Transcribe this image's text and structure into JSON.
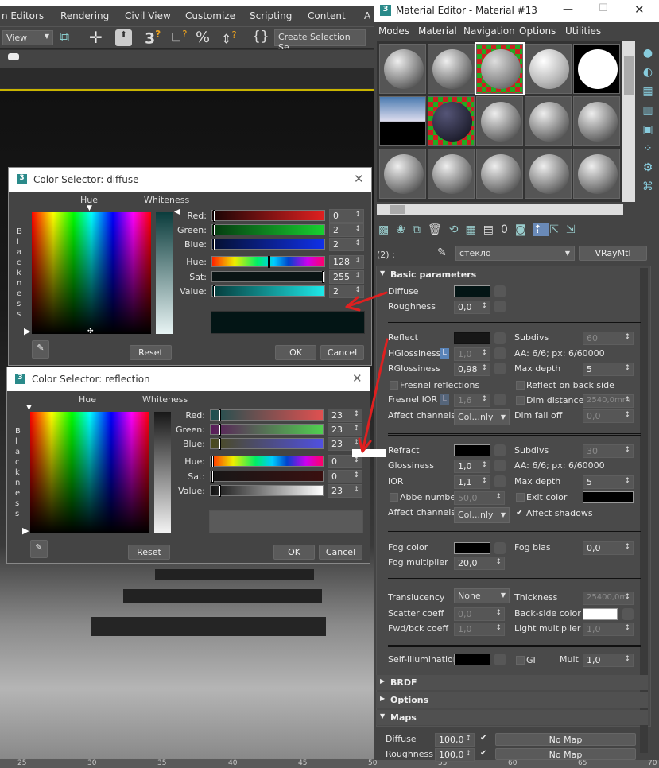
{
  "main_menu": [
    "n Editors",
    "Rendering",
    "Civil View",
    "Customize",
    "Scripting",
    "Content",
    "A"
  ],
  "toolbar": {
    "view_dropdown": "View",
    "selection_set": "Create Selection Se"
  },
  "ruler_ticks": [
    "25",
    "30",
    "35",
    "40",
    "45",
    "50",
    "55",
    "60",
    "65",
    "70"
  ],
  "material_editor": {
    "title": "Material Editor - Material #13",
    "menu": [
      "Modes",
      "Material",
      "Navigation",
      "Options",
      "Utilities"
    ],
    "slot_label": "(2) :",
    "material_name": "стекло",
    "material_type": "VRayMtl",
    "basic_parameters": "Basic parameters",
    "diffuse": {
      "label": "Diffuse",
      "color": "#031515"
    },
    "roughness": {
      "label": "Roughness",
      "value": "0,0"
    },
    "reflect": {
      "label": "Reflect",
      "color": "#171717"
    },
    "subdivs_reflect": {
      "label": "Subdivs",
      "value": "60"
    },
    "hglossiness": {
      "label": "HGlossiness",
      "lock": "L",
      "value": "1,0"
    },
    "aa_reflect": "AA: 6/6; px: 6/60000",
    "rglossiness": {
      "label": "RGlossiness",
      "value": "0,98"
    },
    "max_depth_reflect": {
      "label": "Max depth",
      "value": "5"
    },
    "fresnel": {
      "label": "Fresnel reflections",
      "checked": false
    },
    "reflect_back": {
      "label": "Reflect on back side",
      "checked": false
    },
    "fresnel_ior": {
      "label": "Fresnel IOR",
      "lock": "L",
      "value": "1,6"
    },
    "dim_distance": {
      "label": "Dim distance",
      "value": "2540,0mm",
      "checked": false
    },
    "affect_channels_reflect": {
      "label": "Affect channels",
      "value": "Col...nly"
    },
    "dim_falloff": {
      "label": "Dim fall off",
      "value": "0,0"
    },
    "refract": {
      "label": "Refract",
      "color": "#000000"
    },
    "subdivs_refract": {
      "label": "Subdivs",
      "value": "30"
    },
    "glossiness": {
      "label": "Glossiness",
      "value": "1,0"
    },
    "aa_refract": "AA: 6/6; px: 6/60000",
    "ior": {
      "label": "IOR",
      "value": "1,1"
    },
    "max_depth_refract": {
      "label": "Max depth",
      "value": "5"
    },
    "abbe": {
      "label": "Abbe number",
      "value": "50,0",
      "checked": false
    },
    "exit_color": {
      "label": "Exit color",
      "checked": false,
      "color": "#000000"
    },
    "affect_channels_refract": {
      "label": "Affect channels",
      "value": "Col...nly"
    },
    "affect_shadows": {
      "label": "Affect shadows",
      "checked": true
    },
    "fog_color": {
      "label": "Fog color",
      "color": "#000000"
    },
    "fog_bias": {
      "label": "Fog bias",
      "value": "0,0"
    },
    "fog_multiplier": {
      "label": "Fog multiplier",
      "value": "20,0"
    },
    "translucency": {
      "label": "Translucency",
      "value": "None"
    },
    "thickness": {
      "label": "Thickness",
      "value": "25400,0m"
    },
    "scatter": {
      "label": "Scatter coeff",
      "value": "0,0"
    },
    "back_side": {
      "label": "Back-side color",
      "color": "#ffffff"
    },
    "fwd_bck": {
      "label": "Fwd/bck coeff",
      "value": "1,0"
    },
    "light_mult": {
      "label": "Light multiplier",
      "value": "1,0"
    },
    "self_illum": {
      "label": "Self-illumination",
      "color": "#000000"
    },
    "gi": {
      "label": "GI",
      "checked": false
    },
    "mult": {
      "label": "Mult",
      "value": "1,0"
    },
    "rollouts": {
      "brdf": "BRDF",
      "options": "Options",
      "maps": "Maps"
    },
    "maps": [
      {
        "label": "Diffuse",
        "value": "100,0",
        "checked": true,
        "map": "No Map"
      },
      {
        "label": "Roughness",
        "value": "100,0",
        "checked": true,
        "map": "No Map"
      }
    ]
  },
  "cs_diffuse": {
    "title": "Color Selector: diffuse",
    "hue": "Hue",
    "whiteness": "Whiteness",
    "blackness": "Blackness",
    "labels": [
      "Red:",
      "Green:",
      "Blue:",
      "Hue:",
      "Sat:",
      "Value:"
    ],
    "values": [
      "0",
      "2",
      "2",
      "128",
      "255",
      "2"
    ],
    "preview": "#031515",
    "reset": "Reset",
    "ok": "OK",
    "cancel": "Cancel"
  },
  "cs_reflection": {
    "title": "Color Selector: reflection",
    "hue": "Hue",
    "whiteness": "Whiteness",
    "blackness": "Blackness",
    "labels": [
      "Red:",
      "Green:",
      "Blue:",
      "Hue:",
      "Sat:",
      "Value:"
    ],
    "values": [
      "23",
      "23",
      "23",
      "0",
      "0",
      "23"
    ],
    "preview": "#5a5a5a",
    "reset": "Reset",
    "ok": "OK",
    "cancel": "Cancel"
  },
  "annotation_color": "#e02020"
}
